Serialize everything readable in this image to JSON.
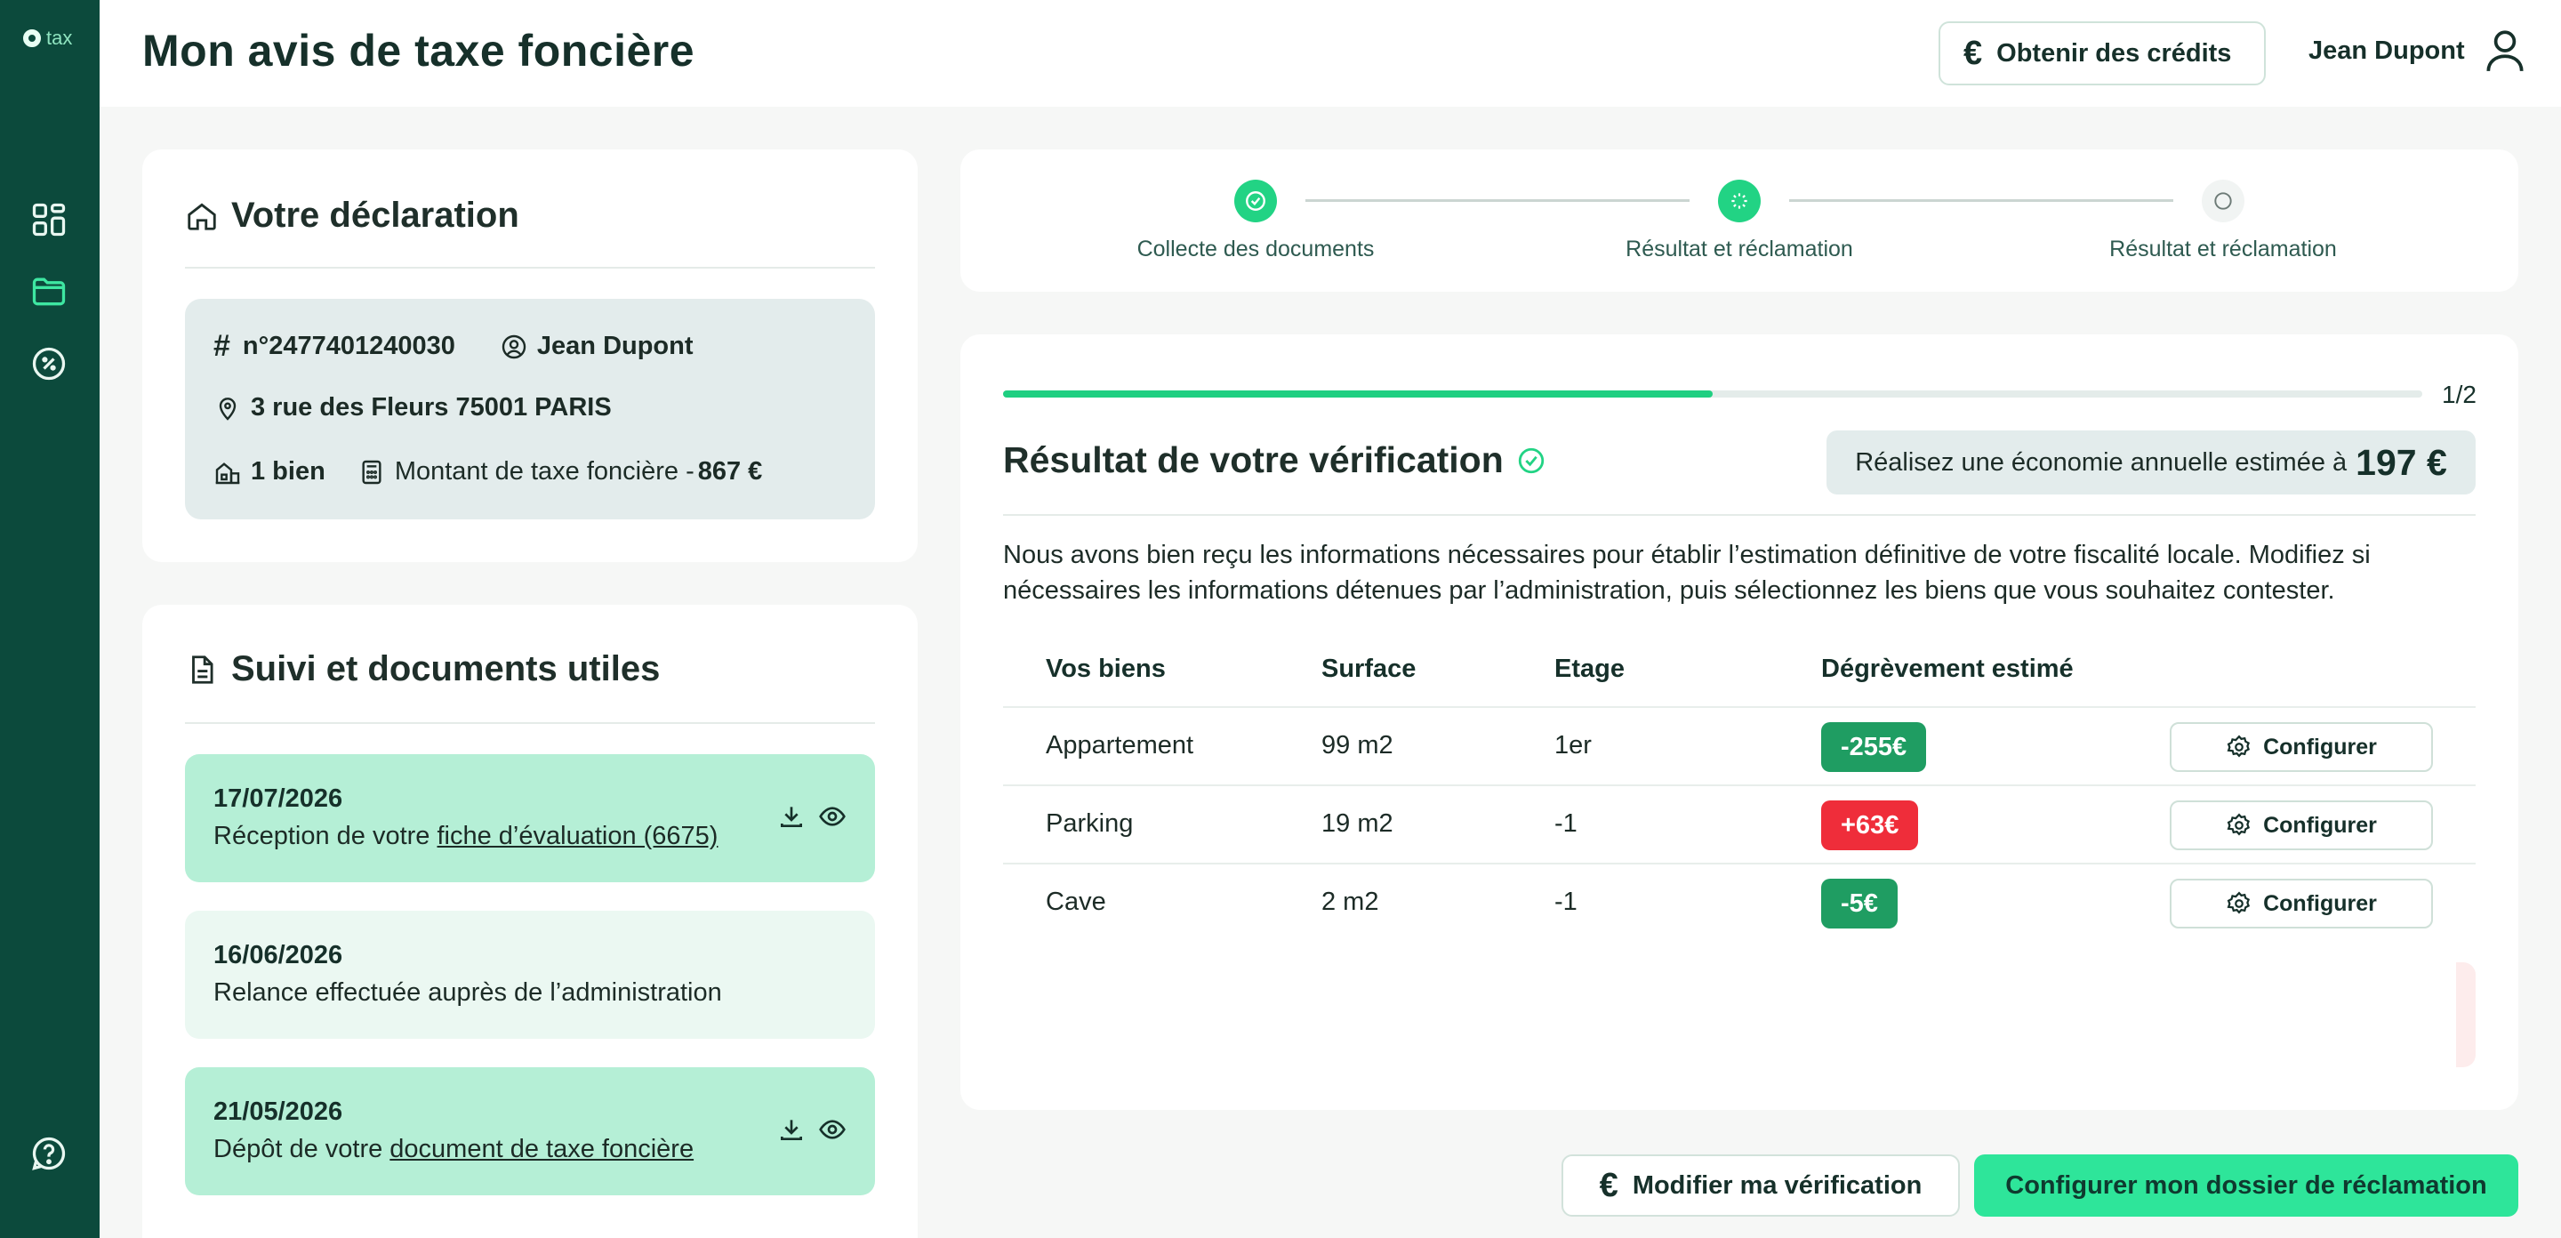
{
  "app": {
    "logo_text": "tax"
  },
  "header": {
    "title": "Mon avis de taxe foncière",
    "credits_button": "Obtenir des crédits",
    "credits_icon": "€",
    "user_name": "Jean Dupont"
  },
  "sidebar": {
    "items": [
      {
        "icon": "dashboard-icon"
      },
      {
        "icon": "folder-icon"
      },
      {
        "icon": "discount-badge-icon"
      }
    ],
    "help_icon": "help-icon"
  },
  "declaration": {
    "title": "Votre déclaration",
    "hash_symbol": "#",
    "number": "n°2477401240030",
    "owner": "Jean Dupont",
    "address": "3 rue des Fleurs 75001 PARIS",
    "properties": "1 bien",
    "tax_label": "Montant de taxe foncière - ",
    "tax_amount": "867 €"
  },
  "documents": {
    "title": "Suivi et documents utiles",
    "items": [
      {
        "date": "17/07/2026",
        "text": "Réception de votre ",
        "link": "fiche d’évaluation (6675)",
        "state": "active"
      },
      {
        "date": "16/06/2026",
        "text": "Relance effectuée auprès de l’administration",
        "link": "",
        "state": "muted"
      },
      {
        "date": "21/05/2026",
        "text": "Dépôt de votre ",
        "link": "document de taxe foncière",
        "state": "active"
      }
    ]
  },
  "stepper": {
    "steps": [
      {
        "label": "Collecte des documents",
        "status": "done"
      },
      {
        "label": "Résultat et réclamation",
        "status": "current"
      },
      {
        "label": "Résultat et réclamation",
        "status": "todo"
      }
    ]
  },
  "result": {
    "progress_fraction": 0.5,
    "progress_text": "1/2",
    "title": "Résultat de votre vérification",
    "savings_label": "Réalisez une économie annuelle estimée à",
    "savings_amount": "197 €",
    "description": "Nous avons bien reçu les informations nécessaires pour établir l’estimation définitive de votre fiscalité locale. Modifiez si nécessaires les informations détenues par l’administration, puis sélectionnez les biens que vous souhaitez contester.",
    "table": {
      "headers": [
        "Vos biens",
        "Surface",
        "Etage",
        "Dégrèvement estimé"
      ],
      "rows": [
        {
          "bien": "Appartement",
          "surface": "99 m2",
          "etage": "1er",
          "degrevement": "-255€",
          "tone": "neg",
          "action": "Configurer"
        },
        {
          "bien": "Parking",
          "surface": "19 m2",
          "etage": "-1",
          "degrevement": "+63€",
          "tone": "pos",
          "action": "Configurer"
        },
        {
          "bien": "Cave",
          "surface": "2 m2",
          "etage": "-1",
          "degrevement": "-5€",
          "tone": "neg",
          "action": "Configurer"
        }
      ]
    }
  },
  "footer": {
    "modify_button": "Modifier ma vérification",
    "modify_icon": "€",
    "primary_button": "Configurer mon dossier de réclamation"
  },
  "colors": {
    "sidebar": "#0c4a3c",
    "accent": "#2ee59a",
    "badge_negative": "#1f9d62",
    "badge_positive": "#ef2d3a"
  }
}
